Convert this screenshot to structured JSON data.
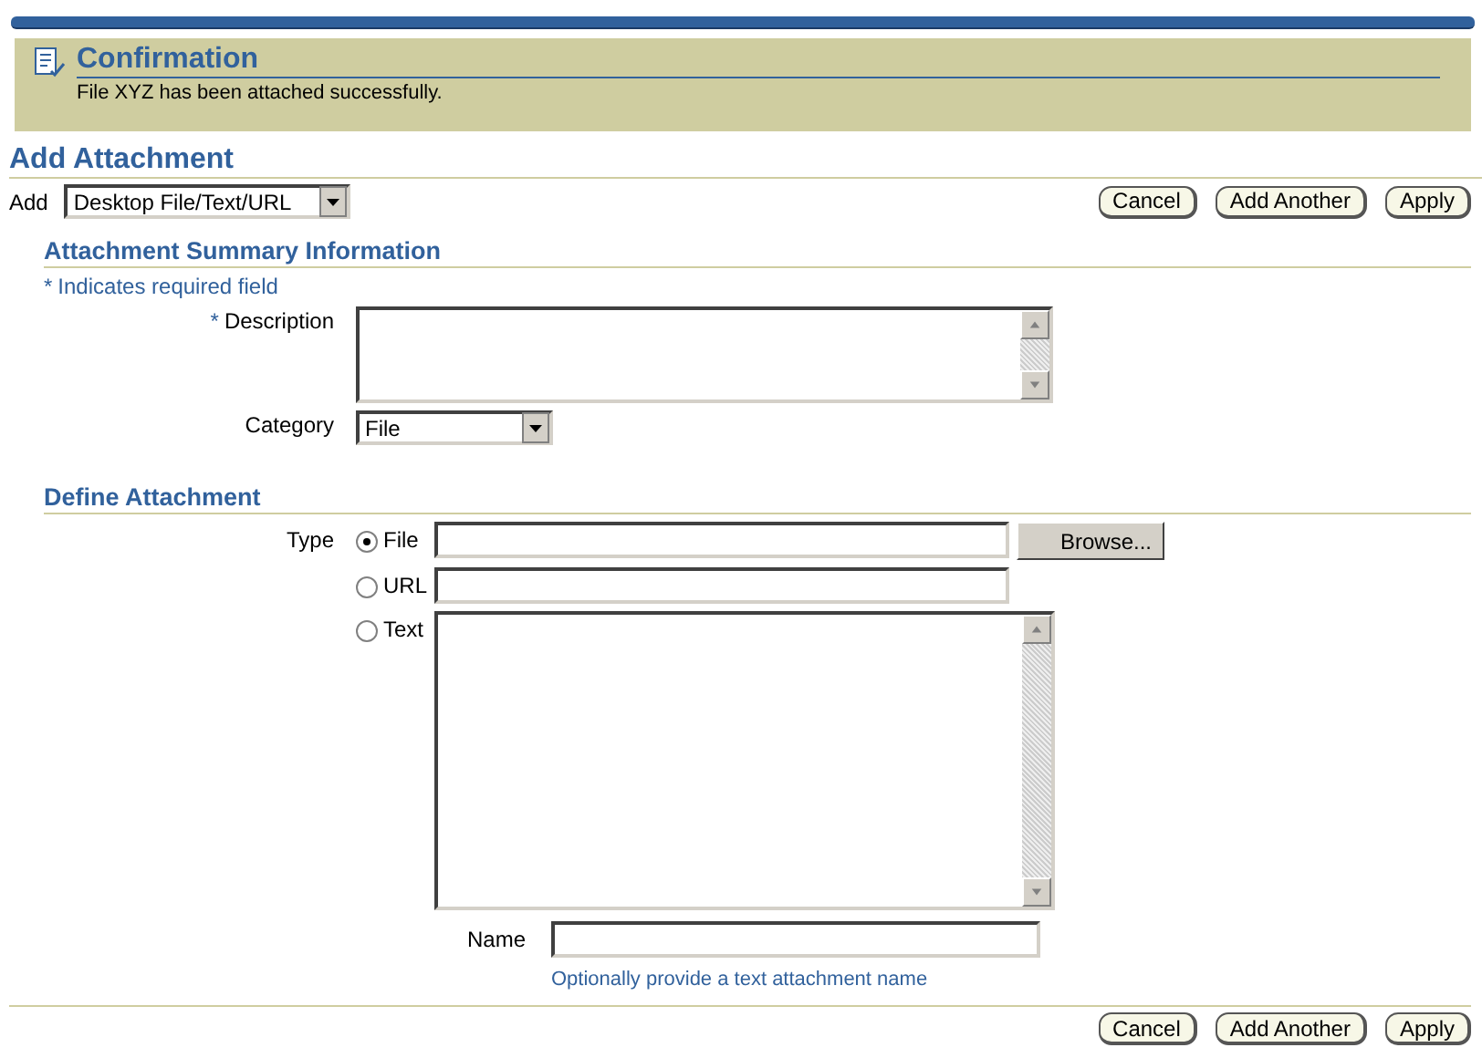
{
  "confirmation": {
    "title": "Confirmation",
    "message": "File XYZ has been attached successfully."
  },
  "page_title": "Add Attachment",
  "add": {
    "label": "Add",
    "value": "Desktop File/Text/URL"
  },
  "buttons": [
    "Cancel",
    "Add Another",
    "Apply"
  ],
  "summary": {
    "heading": "Attachment Summary Information",
    "required_mark": "*",
    "required_note": "Indicates required field",
    "description": {
      "label": "Description",
      "required": true
    },
    "category": {
      "label": "Category",
      "value": "File"
    }
  },
  "define": {
    "heading": "Define Attachment",
    "type_label": "Type",
    "browse": "Browse...",
    "types": [
      {
        "kind": "file",
        "label": "File",
        "selected": true
      },
      {
        "kind": "url",
        "label": "URL",
        "selected": false
      },
      {
        "kind": "text",
        "label": "Text",
        "selected": false
      }
    ],
    "name": {
      "label": "Name",
      "hint": "Optionally provide a text attachment name"
    }
  },
  "bottom_buttons": [
    "Cancel",
    "Add Another",
    "Apply"
  ]
}
